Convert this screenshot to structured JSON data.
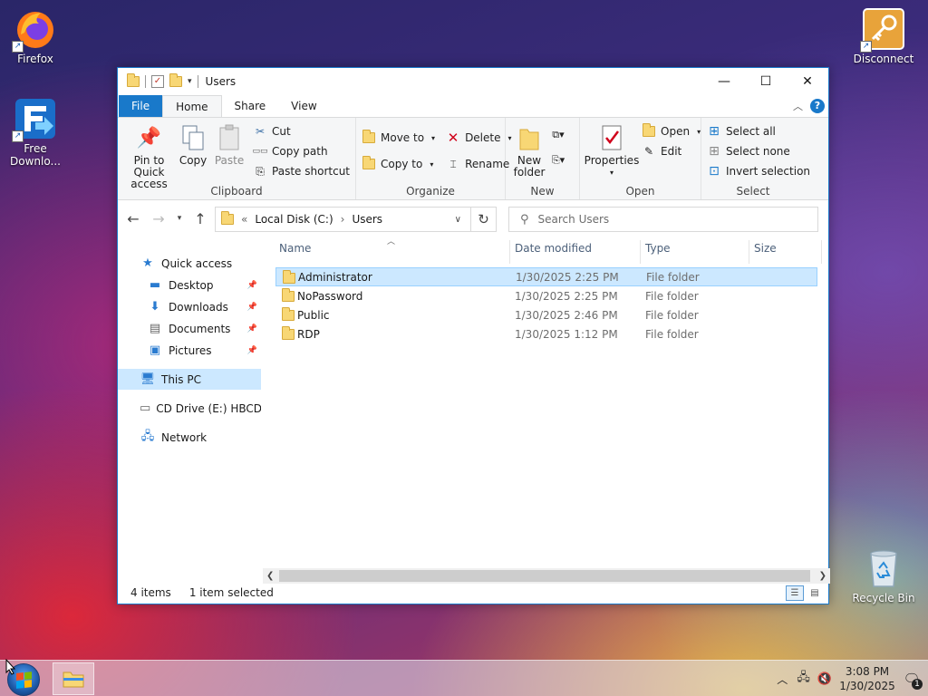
{
  "desktop": {
    "icons": [
      {
        "label": "Firefox"
      },
      {
        "label": "Free Downlo..."
      },
      {
        "label": "Disconnect"
      },
      {
        "label": "Recycle Bin"
      }
    ]
  },
  "window": {
    "title": "Users",
    "tabs": [
      "File",
      "Home",
      "Share",
      "View"
    ],
    "ribbon": {
      "clipboard": {
        "label": "Clipboard",
        "pin": "Pin to Quick access",
        "copy": "Copy",
        "paste": "Paste",
        "cut": "Cut",
        "copy_path": "Copy path",
        "paste_shortcut": "Paste shortcut"
      },
      "organize": {
        "label": "Organize",
        "move_to": "Move to",
        "copy_to": "Copy to",
        "delete": "Delete",
        "rename": "Rename"
      },
      "new": {
        "label": "New",
        "new_folder": "New folder"
      },
      "open": {
        "label": "Open",
        "properties": "Properties",
        "open": "Open",
        "edit": "Edit"
      },
      "select": {
        "label": "Select",
        "select_all": "Select all",
        "select_none": "Select none",
        "invert": "Invert selection"
      }
    },
    "address": {
      "prefix": "«",
      "crumbs": [
        "Local Disk (C:)",
        "Users"
      ],
      "separator": "›"
    },
    "search": {
      "placeholder": "Search Users"
    },
    "nav": {
      "quick_access": "Quick access",
      "desktop": "Desktop",
      "downloads": "Downloads",
      "documents": "Documents",
      "pictures": "Pictures",
      "this_pc": "This PC",
      "cd_drive": "CD Drive (E:) HBCD_P",
      "network": "Network"
    },
    "columns": {
      "name": "Name",
      "date": "Date modified",
      "type": "Type",
      "size": "Size"
    },
    "files": [
      {
        "name": "Administrator",
        "date": "1/30/2025 2:25 PM",
        "type": "File folder"
      },
      {
        "name": "NoPassword",
        "date": "1/30/2025 2:25 PM",
        "type": "File folder"
      },
      {
        "name": "Public",
        "date": "1/30/2025 2:46 PM",
        "type": "File folder"
      },
      {
        "name": "RDP",
        "date": "1/30/2025 1:12 PM",
        "type": "File folder"
      }
    ],
    "status": {
      "items": "4 items",
      "selected": "1 item selected"
    }
  },
  "taskbar": {
    "time": "3:08 PM",
    "date": "1/30/2025",
    "notifications": "1"
  }
}
